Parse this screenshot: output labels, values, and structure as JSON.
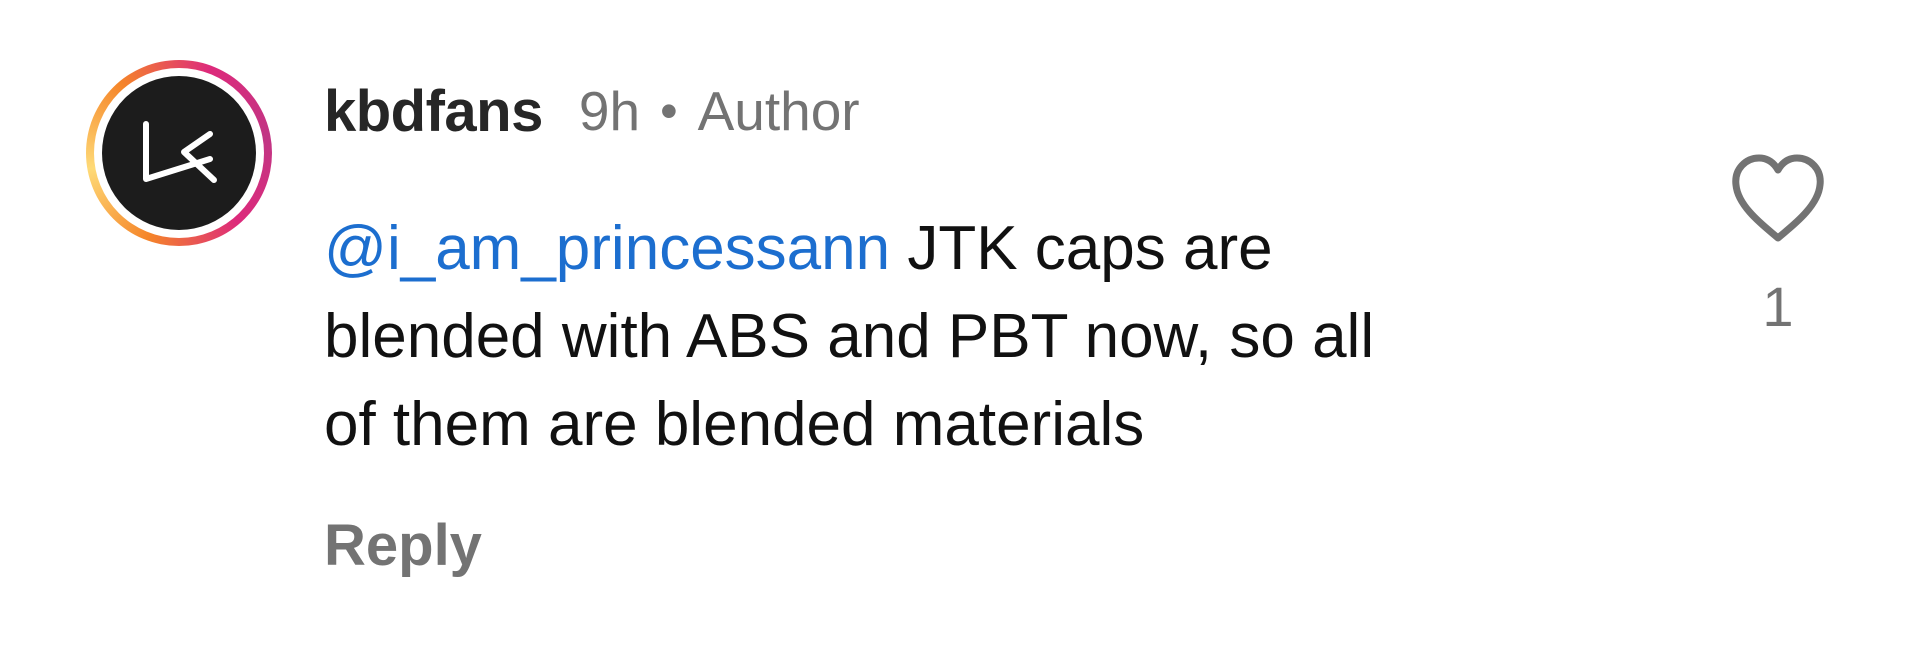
{
  "comment": {
    "avatar": {
      "icon": "kbdfans-logo-icon",
      "ring_colors": [
        "#f58529",
        "#feda77",
        "#dd2a7b",
        "#c13584"
      ]
    },
    "username": "kbdfans",
    "time": "9h",
    "separator": "•",
    "badge": "Author",
    "mention": "@i_am_princessann",
    "text": " JTK caps are\nblended with ABS and PBT now, so all\nof them are blended materials",
    "reply_label": "Reply",
    "like": {
      "icon": "heart-icon",
      "count": "1"
    },
    "colors": {
      "mention": "#1c6ecf",
      "secondary_text": "#737373",
      "primary_text": "#111111"
    }
  }
}
